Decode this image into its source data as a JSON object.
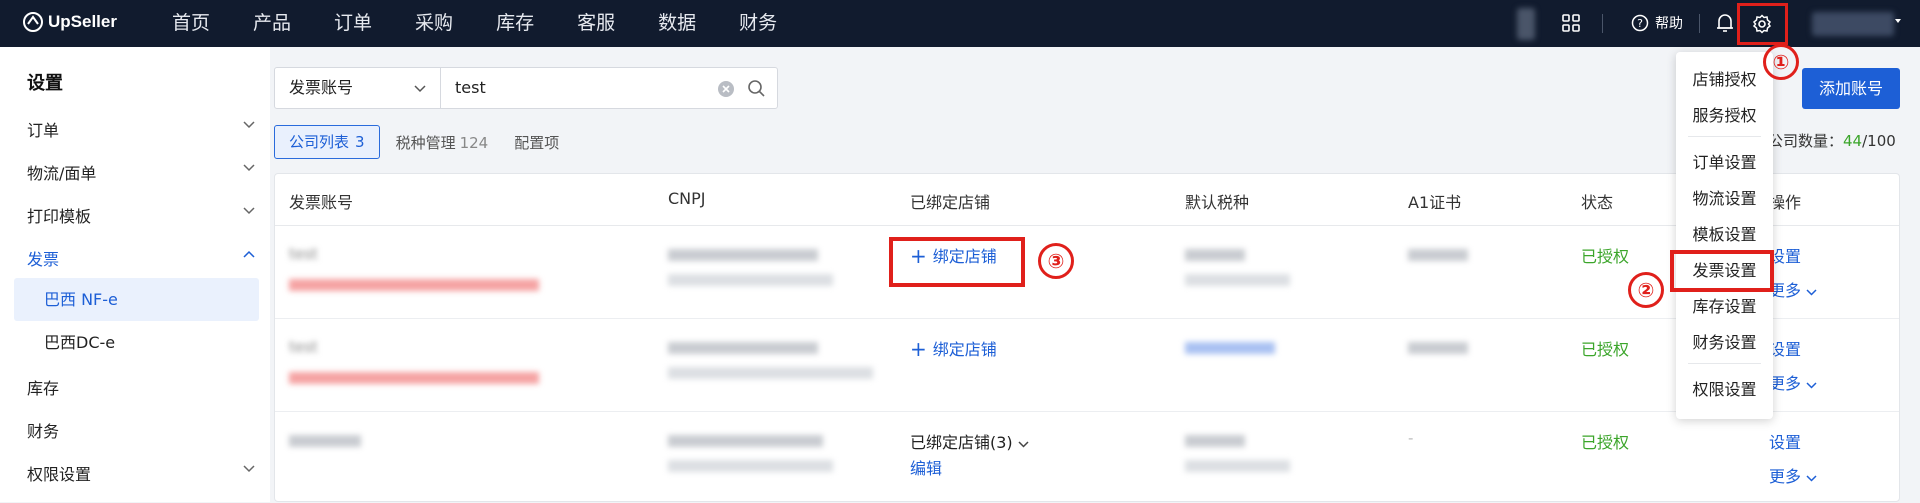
{
  "app": {
    "logo_text": "UpSeller",
    "user": ""
  },
  "nav": [
    "首页",
    "产品",
    "订单",
    "采购",
    "库存",
    "客服",
    "数据",
    "财务"
  ],
  "topbar": {
    "help": "帮助",
    "icons": [
      "grid-icon",
      "help-icon",
      "bell-icon",
      "gear-icon"
    ]
  },
  "sidebar": {
    "title": "设置",
    "items": [
      "订单",
      "物流/面单",
      "打印模板",
      "发票"
    ],
    "sub_items": [
      "巴西 NF-e",
      "巴西DC-e"
    ],
    "items2": [
      "库存",
      "财务",
      "权限设置"
    ]
  },
  "search": {
    "select": "发票账号",
    "value": "test"
  },
  "tabs": [
    {
      "label": "公司列表",
      "count": "3"
    },
    {
      "label": "税种管理",
      "count": "124"
    },
    {
      "label": "配置项",
      "count": ""
    }
  ],
  "add_button": "添加账号",
  "company_count": {
    "label": "公司数量：",
    "used": "44",
    "total": "/100"
  },
  "table": {
    "headers": [
      "发票账号",
      "CNPJ",
      "已绑定店铺",
      "默认税种",
      "A1证书",
      "状态",
      "操作"
    ],
    "rows": [
      {
        "account": "test",
        "account_note": "",
        "cnpj": "",
        "cnpj_sub": "",
        "store": "绑定店铺",
        "store_edit": "",
        "tax": "",
        "cert": "",
        "status": "已授权",
        "op1": "设置",
        "op2": "更多"
      },
      {
        "account": "test",
        "account_note": "",
        "cnpj": "",
        "cnpj_sub": "",
        "store": "绑定店铺",
        "store_edit": "",
        "tax": "",
        "cert": "",
        "status": "已授权",
        "op1": "设置",
        "op2": "更多"
      },
      {
        "account": "",
        "account_note": "",
        "cnpj": "",
        "cnpj_sub": "",
        "store": "已绑定店铺(3)",
        "store_edit": "编辑",
        "tax": "",
        "cert": "-",
        "status": "已授权",
        "op1": "设置",
        "op2": "更多"
      }
    ]
  },
  "dropdown": [
    "店铺授权",
    "服务授权",
    "订单设置",
    "物流设置",
    "模板设置",
    "发票设置",
    "库存设置",
    "财务设置",
    "权限设置"
  ],
  "steps": [
    "①",
    "②",
    "③"
  ]
}
